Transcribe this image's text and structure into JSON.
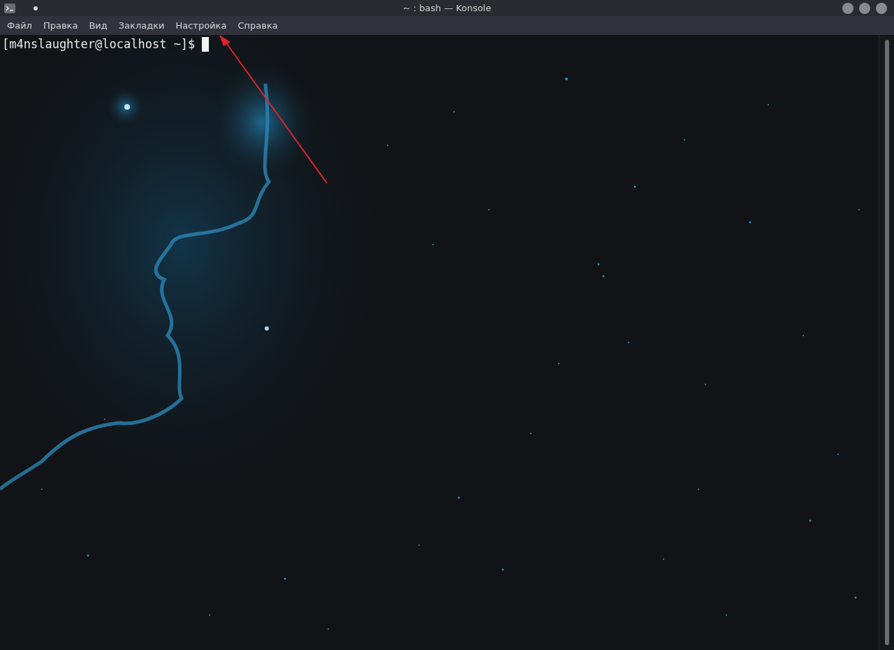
{
  "window": {
    "title": "~ : bash — Konsole"
  },
  "menu": [
    "Файл",
    "Правка",
    "Вид",
    "Закладки",
    "Настройка",
    "Справка"
  ],
  "terminal": {
    "prompt": "[m4nslaughter@localhost ~]$",
    "cursor": true
  }
}
